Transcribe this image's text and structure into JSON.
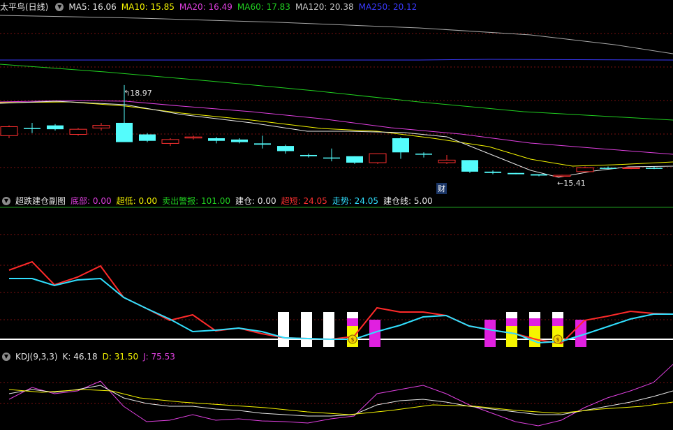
{
  "main": {
    "title": "太平鸟(日线)",
    "ma": [
      {
        "label": "MA5: 16.06",
        "color": "#e8e8e8"
      },
      {
        "label": "MA10: 15.85",
        "color": "#f5f500"
      },
      {
        "label": "MA20: 16.49",
        "color": "#e040e0"
      },
      {
        "label": "MA60: 17.83",
        "color": "#20d020"
      },
      {
        "label": "MA120: 20.38",
        "color": "#a8a8a8"
      },
      {
        "label": "MA250: 20.12",
        "color": "#3a3aff"
      }
    ],
    "high_label": "18.97",
    "low_label": "15.41",
    "fin_badge": "财"
  },
  "sub": {
    "title": "超跌建仓副图",
    "fields": [
      {
        "label": "底部: 0.00",
        "color": "#e040e0"
      },
      {
        "label": "超低: 0.00",
        "color": "#f5f500"
      },
      {
        "label": "卖出警报: 101.00",
        "color": "#20d020"
      },
      {
        "label": "建仓: 0.00",
        "color": "#e8e8e8"
      },
      {
        "label": "超短: 24.05",
        "color": "#ff3030"
      },
      {
        "label": "走势: 24.05",
        "color": "#30e0ff"
      },
      {
        "label": "建仓线: 5.00",
        "color": "#e8e8e8"
      }
    ]
  },
  "kdj": {
    "title": "KDJ(9,3,3)",
    "fields": [
      {
        "label": "K: 46.18",
        "color": "#e8e8e8"
      },
      {
        "label": "D: 31.50",
        "color": "#f5f500"
      },
      {
        "label": "J: 75.53",
        "color": "#e040e0"
      }
    ]
  },
  "colors": {
    "up": "#ff3030",
    "down": "#54fcfc",
    "grid": "#7a1010"
  },
  "chart_data": {
    "type": "candlestick",
    "price_range": [
      15.41,
      18.97
    ],
    "candles": [
      {
        "o": 17.0,
        "h": 17.4,
        "l": 16.9,
        "c": 17.35,
        "dir": "up"
      },
      {
        "o": 17.3,
        "h": 17.5,
        "l": 17.1,
        "c": 17.3,
        "dir": "down"
      },
      {
        "o": 17.4,
        "h": 17.45,
        "l": 17.2,
        "c": 17.25,
        "dir": "down"
      },
      {
        "o": 17.05,
        "h": 17.3,
        "l": 17.0,
        "c": 17.25,
        "dir": "up"
      },
      {
        "o": 17.3,
        "h": 17.5,
        "l": 17.2,
        "c": 17.4,
        "dir": "up"
      },
      {
        "o": 17.5,
        "h": 18.97,
        "l": 17.0,
        "c": 16.75,
        "dir": "down"
      },
      {
        "o": 17.05,
        "h": 17.1,
        "l": 16.75,
        "c": 16.8,
        "dir": "down"
      },
      {
        "o": 16.7,
        "h": 16.9,
        "l": 16.6,
        "c": 16.85,
        "dir": "up"
      },
      {
        "o": 16.95,
        "h": 17.0,
        "l": 16.85,
        "c": 16.95,
        "dir": "up"
      },
      {
        "o": 16.9,
        "h": 16.95,
        "l": 16.7,
        "c": 16.8,
        "dir": "down"
      },
      {
        "o": 16.85,
        "h": 16.9,
        "l": 16.7,
        "c": 16.75,
        "dir": "down"
      },
      {
        "o": 16.7,
        "h": 17.0,
        "l": 16.5,
        "c": 16.65,
        "dir": "down"
      },
      {
        "o": 16.6,
        "h": 16.65,
        "l": 16.3,
        "c": 16.4,
        "dir": "down"
      },
      {
        "o": 16.25,
        "h": 16.3,
        "l": 16.15,
        "c": 16.2,
        "dir": "down"
      },
      {
        "o": 16.15,
        "h": 16.5,
        "l": 16.0,
        "c": 16.15,
        "dir": "down"
      },
      {
        "o": 16.2,
        "h": 16.2,
        "l": 15.9,
        "c": 15.95,
        "dir": "down"
      },
      {
        "o": 15.95,
        "h": 16.3,
        "l": 15.9,
        "c": 16.3,
        "dir": "up"
      },
      {
        "o": 16.9,
        "h": 16.95,
        "l": 16.1,
        "c": 16.35,
        "dir": "down"
      },
      {
        "o": 16.3,
        "h": 16.35,
        "l": 16.15,
        "c": 16.3,
        "dir": "down"
      },
      {
        "o": 15.95,
        "h": 16.25,
        "l": 15.9,
        "c": 16.05,
        "dir": "up"
      },
      {
        "o": 16.05,
        "h": 16.05,
        "l": 15.55,
        "c": 15.6,
        "dir": "down"
      },
      {
        "o": 15.6,
        "h": 15.65,
        "l": 15.5,
        "c": 15.55,
        "dir": "down"
      },
      {
        "o": 15.55,
        "h": 15.55,
        "l": 15.5,
        "c": 15.5,
        "dir": "down"
      },
      {
        "o": 15.5,
        "h": 15.5,
        "l": 15.42,
        "c": 15.45,
        "dir": "down"
      },
      {
        "o": 15.42,
        "h": 15.48,
        "l": 15.41,
        "c": 15.46,
        "dir": "up"
      },
      {
        "o": 15.6,
        "h": 15.8,
        "l": 15.58,
        "c": 15.75,
        "dir": "up"
      },
      {
        "o": 15.75,
        "h": 15.8,
        "l": 15.7,
        "c": 15.72,
        "dir": "down"
      },
      {
        "o": 15.74,
        "h": 15.78,
        "l": 15.7,
        "c": 15.76,
        "dir": "up"
      },
      {
        "o": 15.75,
        "h": 15.8,
        "l": 15.7,
        "c": 15.74,
        "dir": "down"
      }
    ]
  }
}
